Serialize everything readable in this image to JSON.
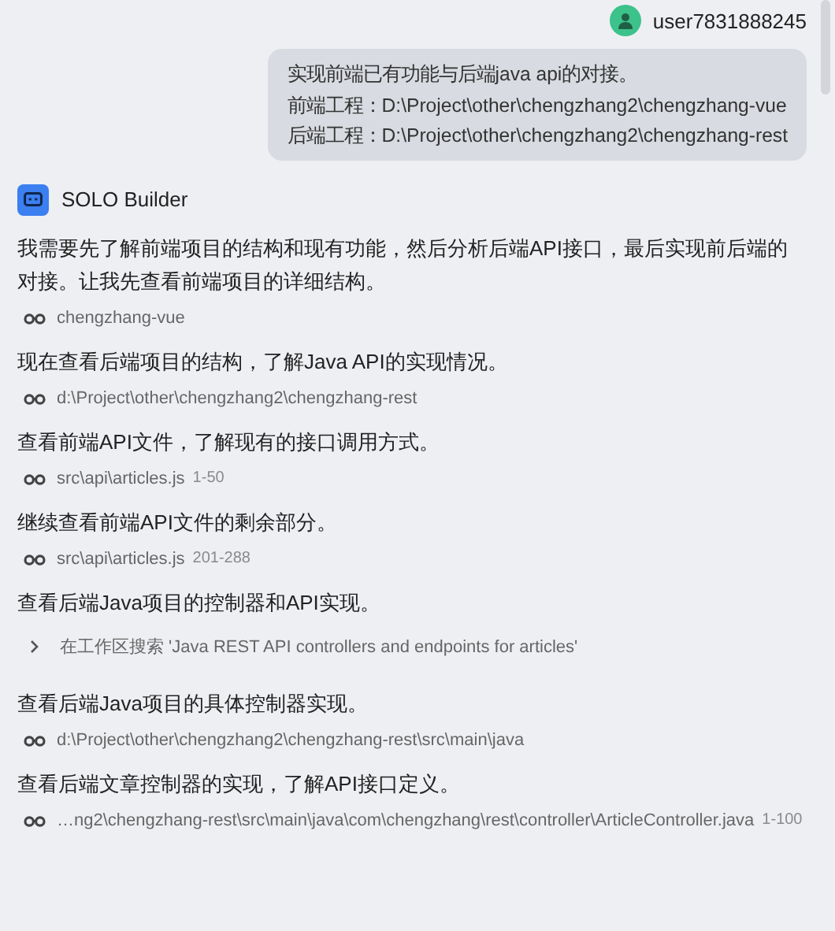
{
  "user": {
    "name": "user7831888245",
    "message_lines": [
      "实现前端已有功能与后端java api的对接。",
      "前端工程：D:\\Project\\other\\chengzhang2\\chengzhang-vue",
      "后端工程：D:\\Project\\other\\chengzhang2\\chengzhang-rest"
    ]
  },
  "agent": {
    "name": "SOLO Builder"
  },
  "steps": [
    {
      "kind": "message",
      "text": "我需要先了解前端项目的结构和现有功能，然后分析后端API接口，最后实现前后端的对接。让我先查看前端项目的详细结构。"
    },
    {
      "kind": "view",
      "path": "chengzhang-vue"
    },
    {
      "kind": "message",
      "text": "现在查看后端项目的结构，了解Java API的实现情况。"
    },
    {
      "kind": "view",
      "path": "d:\\Project\\other\\chengzhang2\\chengzhang-rest"
    },
    {
      "kind": "message",
      "text": "查看前端API文件，了解现有的接口调用方式。"
    },
    {
      "kind": "view",
      "path": "src\\api\\articles.js",
      "range": "1-50"
    },
    {
      "kind": "message",
      "text": "继续查看前端API文件的剩余部分。"
    },
    {
      "kind": "view",
      "path": "src\\api\\articles.js",
      "range": "201-288"
    },
    {
      "kind": "message",
      "text": "查看后端Java项目的控制器和API实现。"
    },
    {
      "kind": "search",
      "text": "在工作区搜索 'Java REST API controllers and endpoints for articles'"
    },
    {
      "kind": "message",
      "text": "查看后端Java项目的具体控制器实现。"
    },
    {
      "kind": "view",
      "path": "d:\\Project\\other\\chengzhang2\\chengzhang-rest\\src\\main\\java"
    },
    {
      "kind": "message",
      "text": "查看后端文章控制器的实现，了解API接口定义。"
    },
    {
      "kind": "view",
      "path": "…ng2\\chengzhang-rest\\src\\main\\java\\com\\chengzhang\\rest\\controller\\ArticleController.java",
      "range": "1-100"
    }
  ]
}
